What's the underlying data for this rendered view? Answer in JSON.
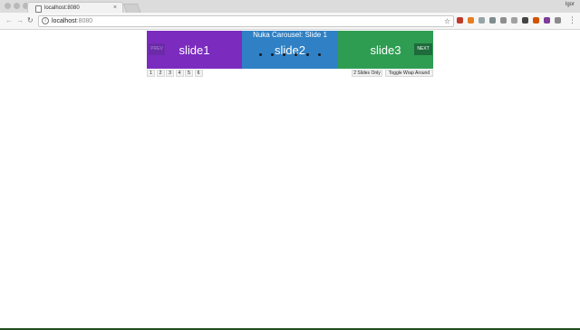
{
  "browser": {
    "tab_title": "localhost:8080",
    "tab_close": "×",
    "profile_name": "Igor",
    "url_host": "localhost",
    "url_port": ":8080",
    "back_icon": "←",
    "forward_icon": "→",
    "reload_icon": "↻",
    "info_icon": "i",
    "star_icon": "☆",
    "menu_icon": "⋮",
    "extensions": [
      {
        "name": "ext-red-icon",
        "color": "#c0392b"
      },
      {
        "name": "ext-orange-icon",
        "color": "#e67e22"
      },
      {
        "name": "ext-gray-icon",
        "color": "#95a5a6"
      },
      {
        "name": "ext-gray2-icon",
        "color": "#7f8c8d"
      },
      {
        "name": "ext-shield-icon",
        "color": "#8e8e8e"
      },
      {
        "name": "ext-gray3-icon",
        "color": "#a0a0a0"
      },
      {
        "name": "ext-dark-icon",
        "color": "#444444"
      },
      {
        "name": "ext-orange2-icon",
        "color": "#d35400"
      },
      {
        "name": "ext-purple-icon",
        "color": "#7d3c98"
      },
      {
        "name": "ext-gray4-icon",
        "color": "#8a8a8a"
      }
    ]
  },
  "carousel": {
    "heading": "Nuka Carousel: Slide 1",
    "prev_label": "PREV",
    "next_label": "NEXT",
    "slides": [
      "slide1",
      "slide2",
      "slide3"
    ],
    "dot_count": 6,
    "colors": {
      "slide1": "#7b2cbf",
      "slide2": "#2f80c4",
      "slide3": "#2e9d52"
    }
  },
  "controls": {
    "page_buttons": [
      "1",
      "2",
      "3",
      "4",
      "5",
      "6"
    ],
    "two_slides_label": "2 Slides Only",
    "wrap_label": "Toggle Wrap Around"
  }
}
